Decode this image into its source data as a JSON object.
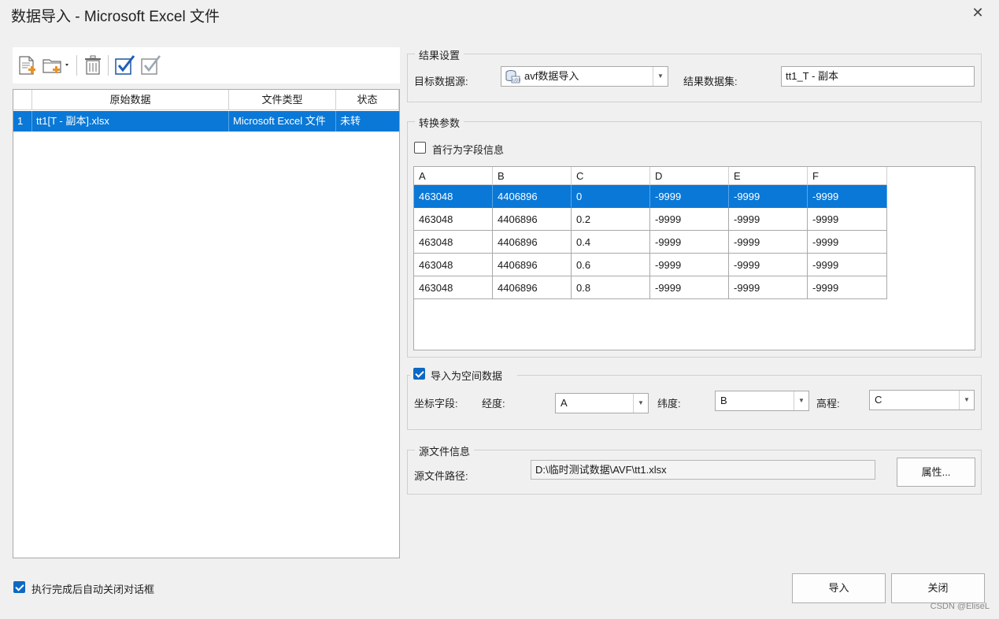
{
  "window": {
    "title": "数据导入 - Microsoft Excel 文件",
    "close_glyph": "✕"
  },
  "toolbar": {
    "items": [
      {
        "name": "add-file-icon"
      },
      {
        "name": "add-folder-icon"
      },
      {
        "name": "delete-icon"
      },
      {
        "name": "select-all-icon"
      },
      {
        "name": "select-none-icon"
      }
    ]
  },
  "file_table": {
    "columns": [
      "",
      "原始数据",
      "文件类型",
      "状态"
    ],
    "rows": [
      {
        "index": "1",
        "source": "tt1[T - 副本].xlsx",
        "type": "Microsoft Excel 文件",
        "status": "未转"
      }
    ]
  },
  "result": {
    "group_title": "结果设置",
    "target_label": "目标数据源:",
    "target_value": "avf数据导入",
    "target_icon": "database-icon",
    "dataset_label": "结果数据集:",
    "dataset_value": "tt1_T - 副本"
  },
  "convert": {
    "group_title": "转换参数",
    "first_row_label": "首行为字段信息",
    "first_row_checked": false,
    "preview_columns": [
      "A",
      "B",
      "C",
      "D",
      "E",
      "F"
    ],
    "preview_rows": [
      [
        "463048",
        "4406896",
        "0",
        "-9999",
        "-9999",
        "-9999"
      ],
      [
        "463048",
        "4406896",
        "0.2",
        "-9999",
        "-9999",
        "-9999"
      ],
      [
        "463048",
        "4406896",
        "0.4",
        "-9999",
        "-9999",
        "-9999"
      ],
      [
        "463048",
        "4406896",
        "0.6",
        "-9999",
        "-9999",
        "-9999"
      ],
      [
        "463048",
        "4406896",
        "0.8",
        "-9999",
        "-9999",
        "-9999"
      ]
    ]
  },
  "spatial": {
    "group_title": "导入为空间数据",
    "checked": true,
    "coord_label": "坐标字段:",
    "lon_label": "经度:",
    "lon_value": "A",
    "lat_label": "纬度:",
    "lat_value": "B",
    "elev_label": "高程:",
    "elev_value": "C"
  },
  "source_info": {
    "group_title": "源文件信息",
    "path_label": "源文件路径:",
    "path_value": "D:\\临时测试数据\\AVF\\tt1.xlsx",
    "properties_button": "属性..."
  },
  "footer": {
    "auto_close_label": "执行完成后自动关闭对话框",
    "auto_close_checked": true,
    "import_button": "导入",
    "close_button": "关闭",
    "watermark": "CSDN @EliseL"
  },
  "colors": {
    "selection": "#0a78d7",
    "accent": "#0c68c4"
  }
}
